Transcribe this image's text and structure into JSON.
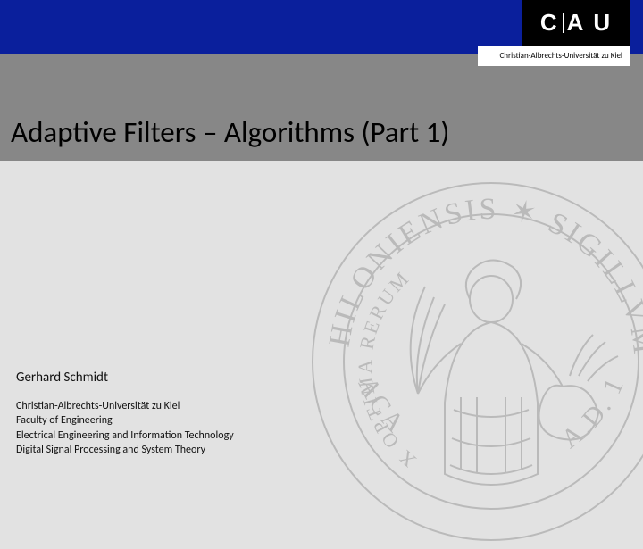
{
  "logo": {
    "letters": "C A U",
    "subtitle": "Christian-Albrechts-Universität zu Kiel"
  },
  "slide": {
    "title": "Adaptive Filters – Algorithms (Part 1)"
  },
  "author": {
    "name": "Gerhard Schmidt",
    "lines": [
      "Christian-Albrechts-Universität zu Kiel",
      "Faculty of Engineering",
      "Electrical Engineering and Information Technology",
      "Digital Signal Processing and System Theory"
    ]
  }
}
